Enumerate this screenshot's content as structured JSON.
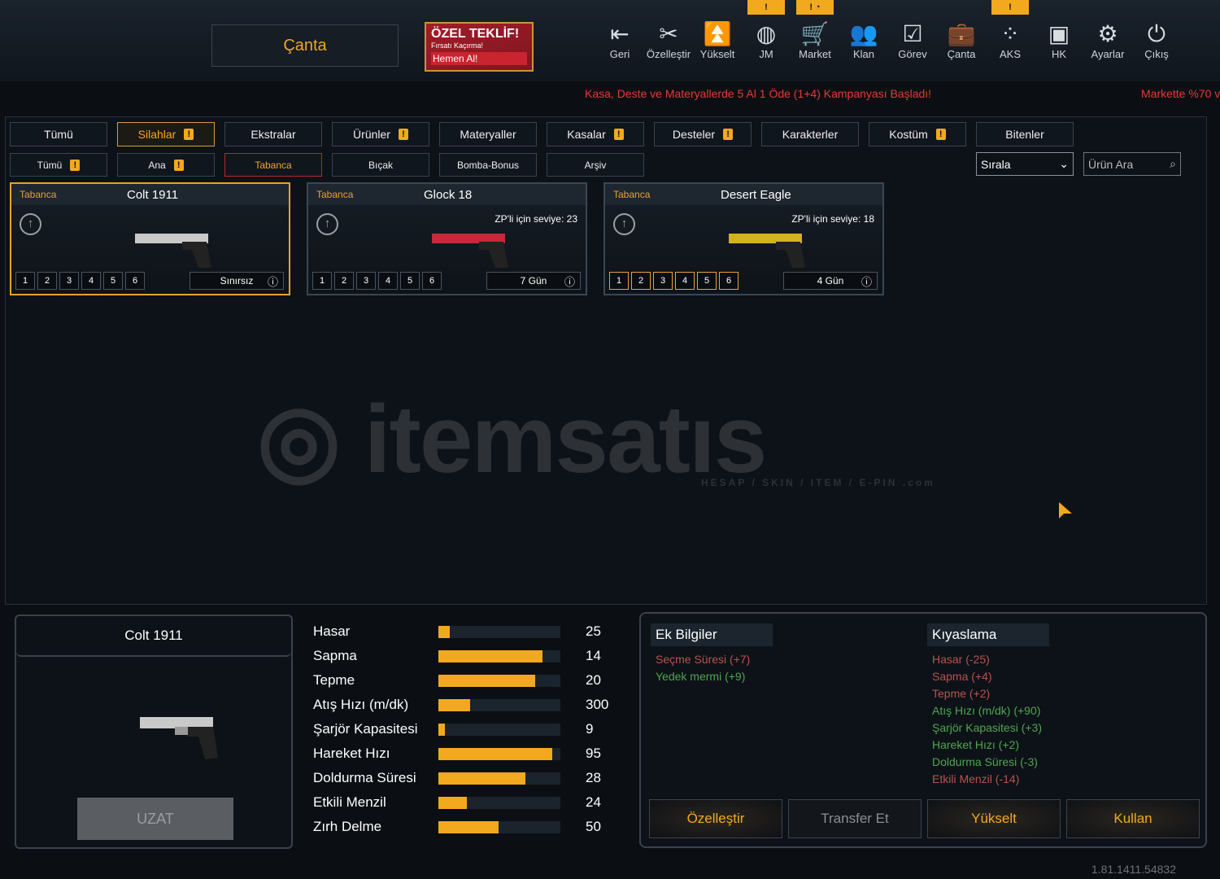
{
  "header": {
    "title": "Çanta",
    "offer": {
      "title": "ÖZEL TEKLİF!",
      "subtitle": "Fırsatı Kaçırma!",
      "cta": "Hemen Al!"
    }
  },
  "nav": [
    {
      "label": "Geri",
      "icon": "back-icon",
      "glyph": "⇤"
    },
    {
      "label": "Özelleştir",
      "icon": "tools-icon",
      "glyph": "✂"
    },
    {
      "label": "Yükselt",
      "icon": "upgrade-icon",
      "glyph": "⏫"
    },
    {
      "label": "JM",
      "icon": "coins-icon",
      "glyph": "◍",
      "badge": "!"
    },
    {
      "label": "Market",
      "icon": "cart-icon",
      "glyph": "🛒",
      "badge": "! ◔"
    },
    {
      "label": "Klan",
      "icon": "clan-icon",
      "glyph": "👥"
    },
    {
      "label": "Görev",
      "icon": "mission-icon",
      "glyph": "☑"
    },
    {
      "label": "Çanta",
      "icon": "bag-icon",
      "glyph": "💼",
      "active": true
    },
    {
      "label": "AKS",
      "icon": "dots-icon",
      "glyph": "⁘",
      "badge": "!"
    },
    {
      "label": "HK",
      "icon": "wallet-icon",
      "glyph": "▣"
    },
    {
      "label": "Ayarlar",
      "icon": "gear-icon",
      "glyph": "⚙"
    },
    {
      "label": "Çıkış",
      "icon": "power-icon",
      "glyph": "⏻"
    }
  ],
  "ticker": [
    "Kasa, Deste ve Materyallerde 5 Al 1 Öde (1+4) Kampanyası Başladı!",
    "Markette %70 v"
  ],
  "tabs": [
    {
      "label": "Tümü"
    },
    {
      "label": "Silahlar",
      "warn": true,
      "sel": true
    },
    {
      "label": "Ekstralar"
    },
    {
      "label": "Ürünler",
      "warn": true
    },
    {
      "label": "Materyaller"
    },
    {
      "label": "Kasalar",
      "warn": true
    },
    {
      "label": "Desteler",
      "warn": true
    },
    {
      "label": "Karakterler"
    },
    {
      "label": "Kostüm",
      "warn": true
    },
    {
      "label": "Bitenler"
    }
  ],
  "subtabs": [
    {
      "label": "Tümü",
      "warn": true
    },
    {
      "label": "Ana",
      "warn": true
    },
    {
      "label": "Tabanca",
      "sel": true
    },
    {
      "label": "Bıçak"
    },
    {
      "label": "Bomba-Bonus"
    },
    {
      "label": "Arşiv"
    }
  ],
  "sort": {
    "label": "Sırala"
  },
  "search": {
    "placeholder": "Ürün Ara"
  },
  "items": [
    {
      "category": "Tabanca",
      "name": "Colt 1911",
      "level": "",
      "duration": "Sınırsız",
      "slots": [
        "1",
        "2",
        "3",
        "4",
        "5",
        "6"
      ],
      "selected": true,
      "color": "#c9c9c9"
    },
    {
      "category": "Tabanca",
      "name": "Glock 18",
      "level": "ZP'li için seviye: 23",
      "duration": "7 Gün",
      "slots": [
        "1",
        "2",
        "3",
        "4",
        "5",
        "6"
      ],
      "color": "#c8283a"
    },
    {
      "category": "Tabanca",
      "name": "Desert Eagle",
      "level": "ZP'li için seviye: 18",
      "duration": "4 Gün",
      "slots": [
        "1",
        "2",
        "3",
        "4",
        "5",
        "6"
      ],
      "orange": true,
      "color": "#d4b21c"
    }
  ],
  "watermark": {
    "text": "itemsatıs",
    "sub": "HESAP / SKIN / ITEM / E-PIN .com"
  },
  "detail": {
    "name": "Colt 1911",
    "extend": "UZAT"
  },
  "stats": [
    {
      "label": "Hasar",
      "value": "25",
      "fill": 0.09
    },
    {
      "label": "Sapma",
      "value": "14",
      "fill": 0.85
    },
    {
      "label": "Tepme",
      "value": "20",
      "fill": 0.79
    },
    {
      "label": "Atış Hızı (m/dk)",
      "value": "300",
      "fill": 0.26
    },
    {
      "label": "Şarjör Kapasitesi",
      "value": "9",
      "fill": 0.05
    },
    {
      "label": "Hareket Hızı",
      "value": "95",
      "fill": 0.93
    },
    {
      "label": "Doldurma Süresi",
      "value": "28",
      "fill": 0.71
    },
    {
      "label": "Etkili Menzil",
      "value": "24",
      "fill": 0.23
    },
    {
      "label": "Zırh Delme",
      "value": "50",
      "fill": 0.49
    }
  ],
  "extra": {
    "title": "Ek Bilgiler",
    "lines": [
      {
        "text": "Seçme Süresi (+7)",
        "c": "#b8534f"
      },
      {
        "text": "Yedek mermi (+9)",
        "c": "#4fa650"
      }
    ]
  },
  "compare": {
    "title": "Kıyaslama",
    "lines": [
      {
        "text": "Hasar (-25)",
        "c": "#b8534f"
      },
      {
        "text": "Sapma (+4)",
        "c": "#b8534f"
      },
      {
        "text": "Tepme (+2)",
        "c": "#b8534f"
      },
      {
        "text": "Atış Hızı (m/dk) (+90)",
        "c": "#4fa650"
      },
      {
        "text": "Şarjör Kapasitesi (+3)",
        "c": "#4fa650"
      },
      {
        "text": "Hareket Hızı (+2)",
        "c": "#4fa650"
      },
      {
        "text": "Doldurma Süresi (-3)",
        "c": "#4fa650"
      },
      {
        "text": "Etkili Menzil (-14)",
        "c": "#b8534f"
      }
    ]
  },
  "actions": [
    {
      "label": "Özelleştir"
    },
    {
      "label": "Transfer Et",
      "disabled": true
    },
    {
      "label": "Yükselt"
    },
    {
      "label": "Kullan"
    }
  ],
  "version": "1.81.1411.54832"
}
